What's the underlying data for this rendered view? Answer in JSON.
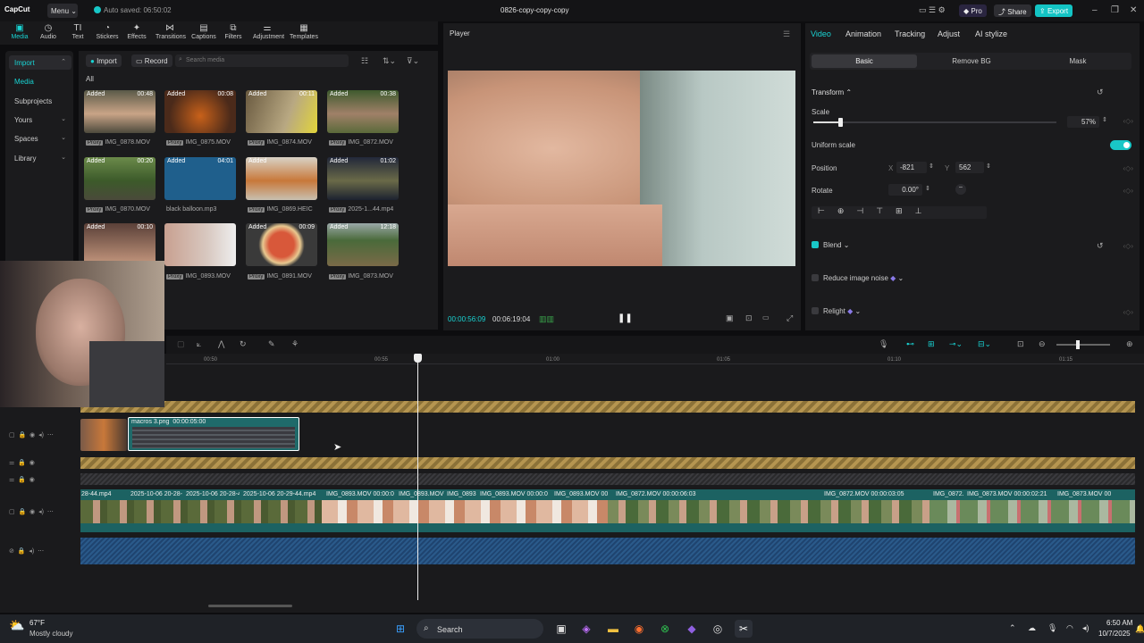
{
  "app": {
    "logo": "CapCut",
    "menu_label": "Menu",
    "autosave": "Auto saved: 06:50:02",
    "title": "0826-copy-copy-copy"
  },
  "header": {
    "pro_label": "Pro",
    "share_label": "Share",
    "export_label": "Export"
  },
  "toolbar": [
    "Media",
    "Audio",
    "Text",
    "Stickers",
    "Effects",
    "Transitions",
    "Captions",
    "Filters",
    "Adjustment",
    "Templates"
  ],
  "leftnav": {
    "import": "Import",
    "media": "Media",
    "subprojects": "Subprojects",
    "yours": "Yours",
    "spaces": "Spaces",
    "library": "Library"
  },
  "media": {
    "import_label": "Import",
    "record_label": "Record",
    "search_placeholder": "Search media",
    "filter_all": "All",
    "items": [
      {
        "added": "Added",
        "duration": "00:48",
        "label": "IMG_0878.MOV",
        "proxy": "Proxy"
      },
      {
        "added": "Added",
        "duration": "00:08",
        "label": "IMG_0875.MOV",
        "proxy": "Proxy"
      },
      {
        "added": "Added",
        "duration": "00:11",
        "label": "IMG_0874.MOV",
        "proxy": "Proxy"
      },
      {
        "added": "Added",
        "duration": "00:38",
        "label": "IMG_0872.MOV",
        "proxy": "Proxy"
      },
      {
        "added": "Added",
        "duration": "00:20",
        "label": "IMG_0870.MOV",
        "proxy": "Proxy"
      },
      {
        "added": "Added",
        "duration": "04:01",
        "label": "black balloon.mp3",
        "proxy": ""
      },
      {
        "added": "Added",
        "duration": "",
        "label": "IMG_0869.HEIC",
        "proxy": "Proxy"
      },
      {
        "added": "Added",
        "duration": "01:02",
        "label": "2025-1...44.mp4",
        "proxy": "Proxy"
      },
      {
        "added": "Added",
        "duration": "00:10",
        "label": "",
        "proxy": ""
      },
      {
        "added": "",
        "duration": "",
        "label": "IMG_0893.MOV",
        "proxy": "Proxy"
      },
      {
        "added": "Added",
        "duration": "00:09",
        "label": "IMG_0891.MOV",
        "proxy": "Proxy"
      },
      {
        "added": "Added",
        "duration": "12:18",
        "label": "IMG_0873.MOV",
        "proxy": "Proxy"
      }
    ]
  },
  "player": {
    "title": "Player",
    "current": "00:00:56:09",
    "total": "00:06:19:04"
  },
  "props": {
    "tabs": [
      "Video",
      "Animation",
      "Tracking",
      "Adjust",
      "AI stylize"
    ],
    "subtabs": [
      "Basic",
      "Remove BG",
      "Mask"
    ],
    "transform": "Transform",
    "scale_label": "Scale",
    "scale_value": "57%",
    "scale_fraction": 0.57,
    "uniform_scale": "Uniform scale",
    "position_label": "Position",
    "pos_x_label": "X",
    "pos_x": "-821",
    "pos_y_label": "Y",
    "pos_y": "562",
    "rotate_label": "Rotate",
    "rotate_value": "0.00°",
    "blend": "Blend",
    "reduce_noise": "Reduce image noise",
    "relight": "Relight"
  },
  "timeline": {
    "ruler": [
      "00:50",
      "00:55",
      "01:00",
      "01:05",
      "01:10",
      "01:15"
    ],
    "overlay_clip": {
      "name": "macros 3.png",
      "time": "00:00:05:00"
    },
    "main_clips": [
      {
        "name": "28-44.mp4"
      },
      {
        "name": "2025-10-06 20-28-44.mp4"
      },
      {
        "name": "2025-10-06 20-28-44.mp4"
      },
      {
        "name": "2025-10-06 20-29-44.mp4"
      },
      {
        "name": "IMG_0893.MOV 00:00:0"
      },
      {
        "name": "IMG_0893.MOV"
      },
      {
        "name": "IMG_0893"
      },
      {
        "name": "IMG_0893.MOV 00:00:0"
      },
      {
        "name": "IMG_0893.MOV 00"
      },
      {
        "name": "IMG_0872.MOV 00:00:06:03"
      },
      {
        "name": "IMG_0872.MOV 00:00:03:05"
      },
      {
        "name": "IMG_0872.I"
      },
      {
        "name": "IMG_0873.MOV 00:00:02:21"
      },
      {
        "name": "IMG_0873.MOV 00"
      }
    ]
  },
  "taskbar": {
    "weather_temp": "67°F",
    "weather_desc": "Mostly cloudy",
    "search": "Search",
    "time": "6:50 AM",
    "date": "10/7/2025"
  }
}
